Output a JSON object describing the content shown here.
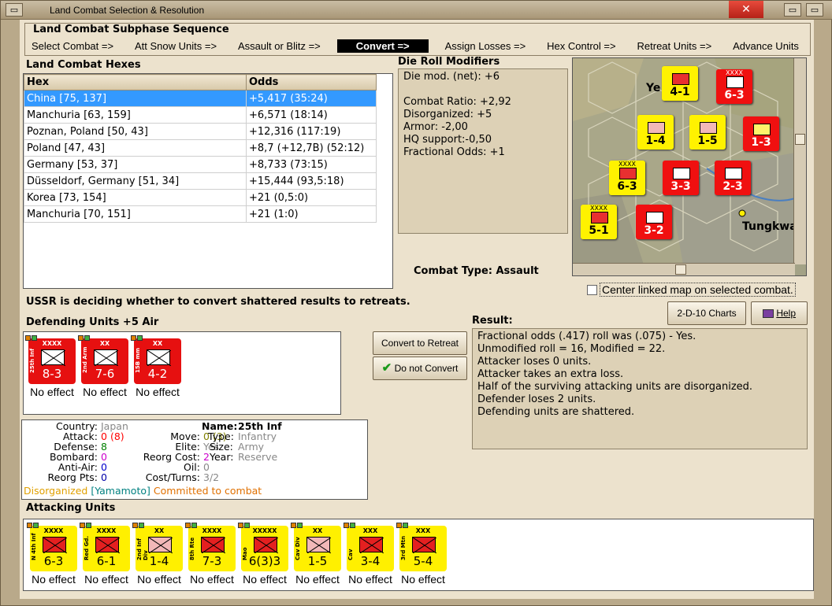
{
  "window": {
    "title": "Land Combat Selection & Resolution",
    "close_label": "✕",
    "left_btn": "▭",
    "right_btn": "▭",
    "right_btn2": "▭"
  },
  "sequence": {
    "heading": "Land Combat Subphase Sequence",
    "steps": [
      {
        "label": "Select Combat =>",
        "active": false
      },
      {
        "label": "Att Snow Units =>",
        "active": false
      },
      {
        "label": "Assault or Blitz =>",
        "active": false
      },
      {
        "label": "Convert =>",
        "active": true
      },
      {
        "label": "Assign Losses =>",
        "active": false
      },
      {
        "label": "Hex Control =>",
        "active": false
      },
      {
        "label": "Retreat Units =>",
        "active": false
      },
      {
        "label": "Advance Units",
        "active": false
      }
    ]
  },
  "hexes": {
    "heading": "Land Combat Hexes",
    "col_hex": "Hex",
    "col_odds": "Odds",
    "rows": [
      {
        "hex": "China [75, 137]",
        "odds": "+5,417 (35:24)",
        "selected": true
      },
      {
        "hex": "Manchuria [63, 159]",
        "odds": "+6,571 (18:14)"
      },
      {
        "hex": "Poznan, Poland [50, 43]",
        "odds": "+12,316 (117:19)"
      },
      {
        "hex": "Poland [47, 43]",
        "odds": "+8,7 (+12,7B) (52:12)"
      },
      {
        "hex": "Germany [53, 37]",
        "odds": "+8,733 (73:15)"
      },
      {
        "hex": "Düsseldorf, Germany [51, 34]",
        "odds": "+15,444 (93,5:18)"
      },
      {
        "hex": "Korea [73, 154]",
        "odds": "+21 (0,5:0)"
      },
      {
        "hex": "Manchuria [70, 151]",
        "odds": "+21 (1:0)"
      }
    ]
  },
  "modifiers": {
    "heading": "Die Roll Modifiers",
    "net": "Die mod. (net): +6",
    "lines": [
      "Combat Ratio: +2,92",
      "Disorganized: +5",
      "Armor: -2,00",
      "HQ support:-0,50",
      "Fractional Odds: +1"
    ]
  },
  "combat_type": {
    "label": "Combat Type:",
    "value": "Assault"
  },
  "map": {
    "place_label": "Tungkwa",
    "place_label2": "Ye",
    "center_label": "Center linked map on selected combat."
  },
  "status_line": "USSR is deciding whether to convert shattered results to retreats.",
  "buttons": {
    "charts": "2-D-10 Charts",
    "help": "Help",
    "convert": "Convert to Retreat",
    "no_convert": "Do not Convert"
  },
  "defending": {
    "heading": "Defending Units +5 Air",
    "units": [
      {
        "name": "25th Inf",
        "size": "XXXX",
        "stat": "8-3",
        "effect": "No effect"
      },
      {
        "name": "2nd Arm",
        "size": "XX",
        "stat": "7-6",
        "effect": "No effect"
      },
      {
        "name": "15B mm",
        "size": "XX",
        "stat": "4-2",
        "effect": "No effect"
      }
    ]
  },
  "result": {
    "heading": "Result:",
    "lines": [
      "Fractional odds (.417) roll was (.075)  - Yes.",
      "Unmodified roll = 16, Modified = 22.",
      "Attacker loses 0 units.",
      "Attacker takes an extra loss.",
      "Half of the surviving attacking units are disorganized.",
      "Defender loses 2 units.",
      "Defending units are shattered."
    ]
  },
  "details": {
    "country_label": "Country:",
    "country": "Japan",
    "attack_label": "Attack:",
    "attack": "0",
    "attack_paren": "(8)",
    "defense_label": "Defense:",
    "defense": "8",
    "bombard_label": "Bombard:",
    "bombard": "0",
    "antiair_label": "Anti-Air:",
    "antiair": "0",
    "reorgpts_label": "Reorg Pts:",
    "reorgpts": "0",
    "name_label": "Name:",
    "name": "25th Inf",
    "move_label": "Move:",
    "move": "0",
    "move_paren": "(3)",
    "type_label": "Type:",
    "type": "Infantry",
    "elite_label": "Elite:",
    "elite": "Yes",
    "size_label": "Size:",
    "size": "Army",
    "reorgcost_label": "Reorg Cost:",
    "reorgcost": "2",
    "year_label": "Year:",
    "year": "Reserve",
    "oil_label": "Oil:",
    "oil": "0",
    "costturns_label": "Cost/Turns:",
    "costturns": "3/2",
    "status_disorg": "Disorganized",
    "status_leader": "[Yamamoto]",
    "status_committed": "Committed to combat",
    "colors": {
      "attack": "#ff0000",
      "defense": "#008000",
      "bombard": "#cc00cc",
      "antiair": "#0000cc",
      "reorgpts": "#0000aa",
      "gray": "#888888",
      "orange": "#e07000",
      "teal": "#008080"
    }
  },
  "attacking": {
    "heading": "Attacking Units",
    "units": [
      {
        "name": "N 4th Inf",
        "size": "XXXX",
        "stat": "6-3",
        "effect": "No effect"
      },
      {
        "name": "Red Gd.",
        "size": "XXXX",
        "stat": "6-1",
        "effect": "No effect"
      },
      {
        "name": "2nd Inf Div",
        "size": "XX",
        "stat": "1-4",
        "effect": "No effect"
      },
      {
        "name": "8th Rte",
        "size": "XXXX",
        "stat": "7-3",
        "effect": "No effect"
      },
      {
        "name": "Mao",
        "size": "XXXXX",
        "stat": "6(3)3",
        "effect": "No effect"
      },
      {
        "name": "Cav Div",
        "size": "XX",
        "stat": "1-5",
        "effect": "No effect"
      },
      {
        "name": "Cav",
        "size": "XXX",
        "stat": "3-4",
        "effect": "No effect"
      },
      {
        "name": "3rd Mtn",
        "size": "XXX",
        "stat": "5-4",
        "effect": "No effect"
      }
    ]
  }
}
